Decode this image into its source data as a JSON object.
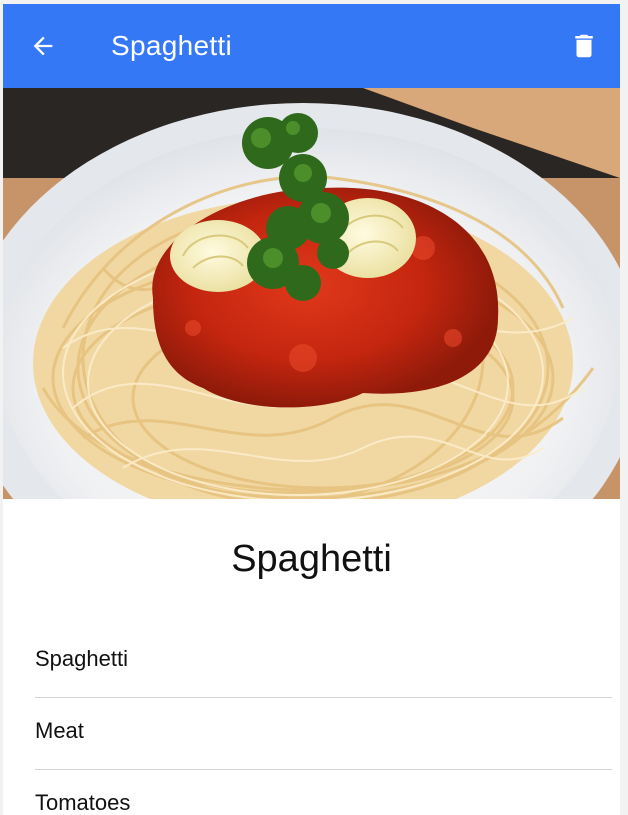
{
  "appbar": {
    "title": "Spaghetti",
    "color": "#3478f6",
    "back_icon": "arrow-left-icon",
    "delete_icon": "trash-icon"
  },
  "recipe": {
    "title": "Spaghetti",
    "ingredients": [
      {
        "label": "Spaghetti"
      },
      {
        "label": "Meat"
      },
      {
        "label": "Tomatoes"
      }
    ]
  }
}
